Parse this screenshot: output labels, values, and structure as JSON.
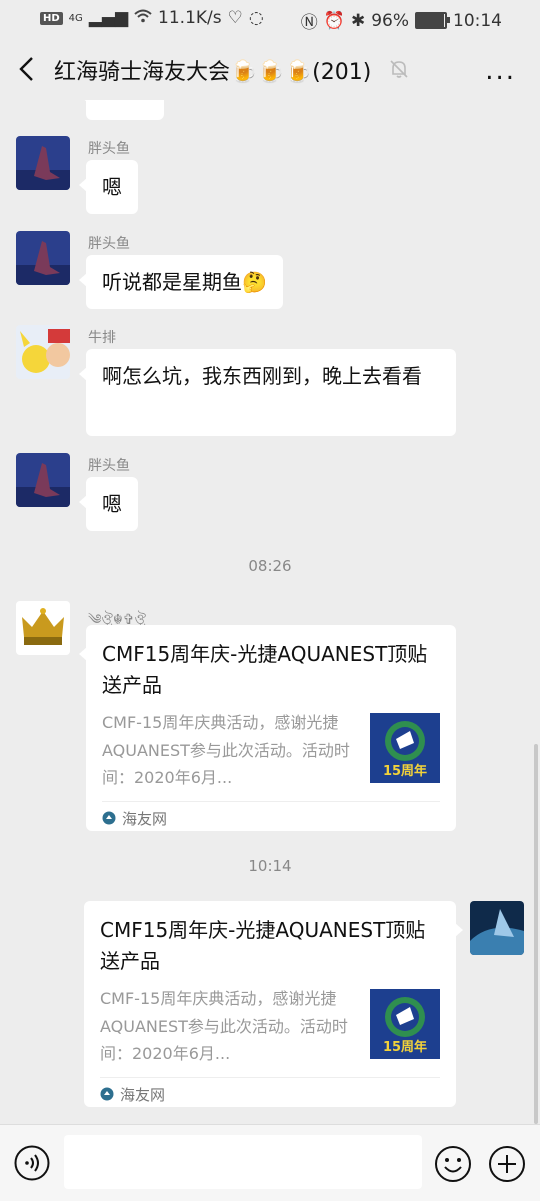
{
  "status": {
    "hd": "HD",
    "net": "4G",
    "speed": "11.1K/s",
    "battery_text": "96%",
    "battery_level": 0.96,
    "time": "10:14"
  },
  "header": {
    "title": "红海骑士海友大会🍺🍺🍺(201)",
    "more": "..."
  },
  "messages": [
    {
      "sender": "胖头鱼",
      "text": "嗯"
    },
    {
      "sender": "胖头鱼",
      "text": "听说都是星期鱼🤔"
    },
    {
      "sender": "牛排",
      "text": "啊怎么坑，我东西刚到，晚上去看看"
    },
    {
      "sender": "胖头鱼",
      "text": "嗯"
    }
  ],
  "time_divider_1": "08:26",
  "card_1": {
    "sender_decor": "༄ঔৣ☬✞ঔৣ",
    "title": "CMF15周年庆-光捷AQUANEST顶贴送产品",
    "desc": "CMF-15周年庆典活动，感谢光捷AQUANEST参与此次活动。活动时间：2020年6月...",
    "source": "海友网",
    "thumb_text": "15周年"
  },
  "time_divider_2": "10:14",
  "card_2": {
    "title": "CMF15周年庆-光捷AQUANEST顶贴送产品",
    "desc": "CMF-15周年庆典活动，感谢光捷AQUANEST参与此次活动。活动时间：2020年6月...",
    "source": "海友网",
    "thumb_text": "15周年"
  },
  "colors": {
    "background": "#ededed",
    "bubble": "#ffffff",
    "meta_text": "#888888"
  }
}
